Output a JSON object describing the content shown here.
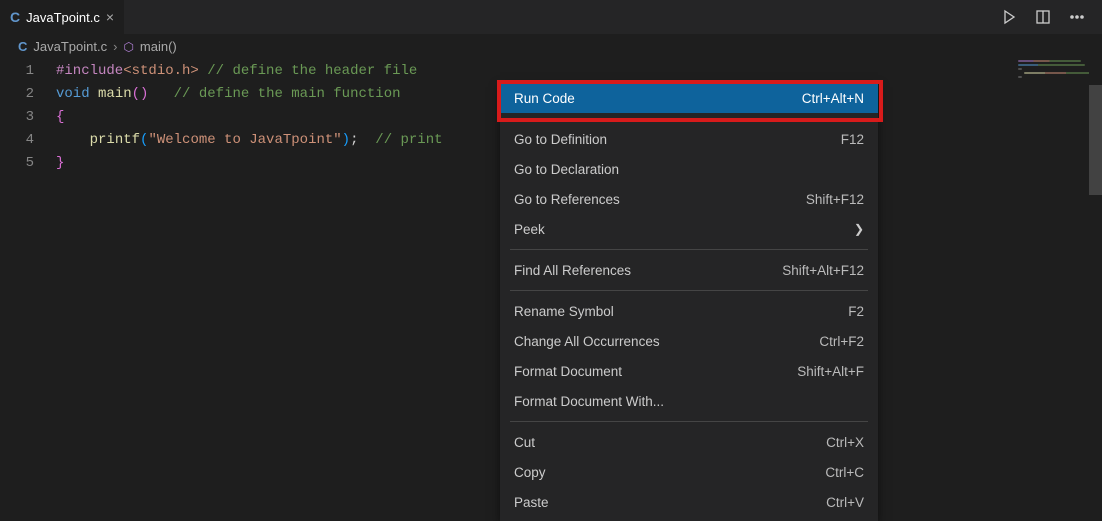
{
  "tab": {
    "filename": "JavaTpoint.c"
  },
  "breadcrumb": {
    "file": "JavaTpoint.c",
    "symbol": "main()"
  },
  "code": {
    "l1": {
      "num": "1",
      "directive": "#include",
      "arg": "<stdio.h>",
      "comment": "// define the header file"
    },
    "l2": {
      "num": "2",
      "kw": "void",
      "fn": "main",
      "comment": "// define the main function"
    },
    "l3": {
      "num": "3",
      "brace": "{"
    },
    "l4": {
      "num": "4",
      "fn": "printf",
      "str": "\"Welcome to JavaTpoint\"",
      "comment": "// print"
    },
    "l5": {
      "num": "5",
      "brace": "}"
    }
  },
  "menu": {
    "items": [
      {
        "label": "Run Code",
        "shortcut": "Ctrl+Alt+N"
      },
      {
        "label": "Go to Definition",
        "shortcut": "F12"
      },
      {
        "label": "Go to Declaration",
        "shortcut": ""
      },
      {
        "label": "Go to References",
        "shortcut": "Shift+F12"
      },
      {
        "label": "Peek",
        "shortcut": "",
        "chevron": true
      },
      {
        "label": "Find All References",
        "shortcut": "Shift+Alt+F12"
      },
      {
        "label": "Rename Symbol",
        "shortcut": "F2"
      },
      {
        "label": "Change All Occurrences",
        "shortcut": "Ctrl+F2"
      },
      {
        "label": "Format Document",
        "shortcut": "Shift+Alt+F"
      },
      {
        "label": "Format Document With...",
        "shortcut": ""
      },
      {
        "label": "Cut",
        "shortcut": "Ctrl+X"
      },
      {
        "label": "Copy",
        "shortcut": "Ctrl+C"
      },
      {
        "label": "Paste",
        "shortcut": "Ctrl+V"
      }
    ]
  }
}
